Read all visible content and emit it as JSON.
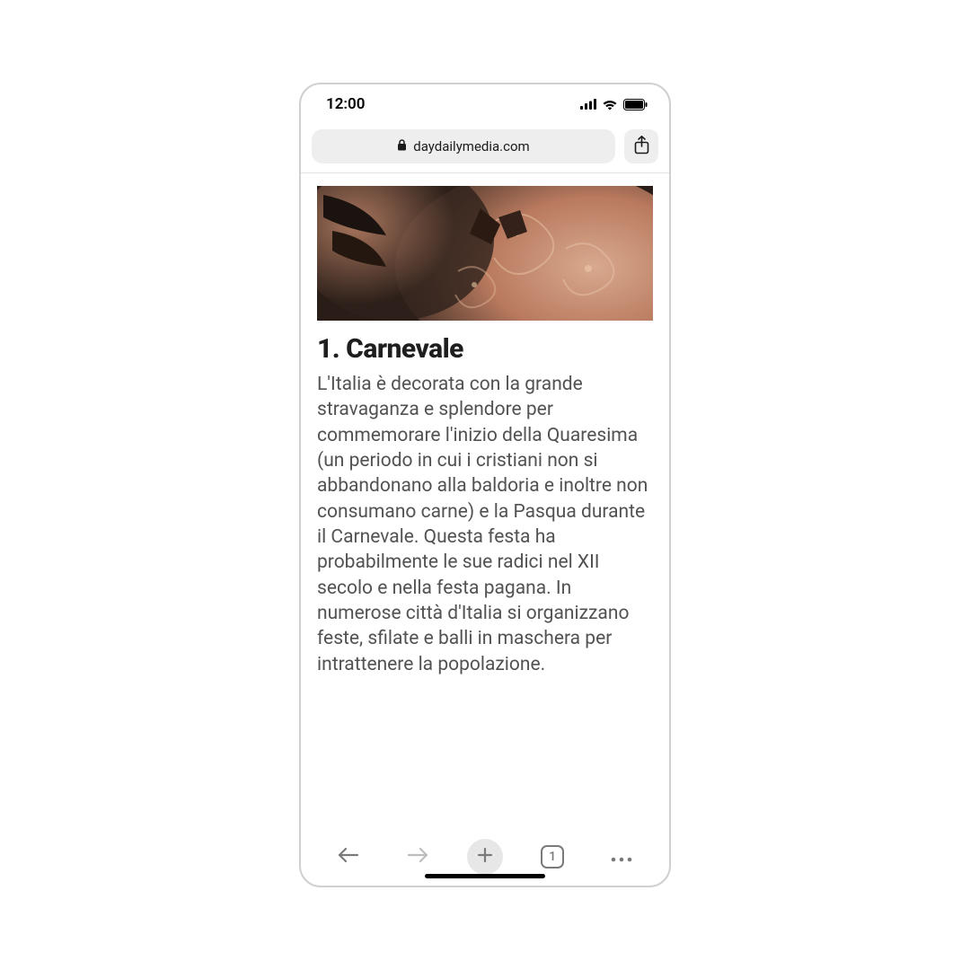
{
  "status": {
    "time": "12:00"
  },
  "addressBar": {
    "domain": "daydailymedia.com"
  },
  "article": {
    "heading": "1. Carnevale",
    "body": "L'Italia è decorata con la grande stravaganza e splendore per commemorare l'inizio della Quaresima (un periodo in cui i cristiani non si abbandonano alla baldoria e inoltre non consumano carne) e la Pasqua durante il Carnevale. Questa festa ha probabilmente le sue radici nel XII secolo e nella festa pagana. In numerose città d'Italia si organizzano feste, sfilate e balli in maschera per intrattenere la popolazione."
  },
  "toolbar": {
    "tabCount": "1"
  }
}
